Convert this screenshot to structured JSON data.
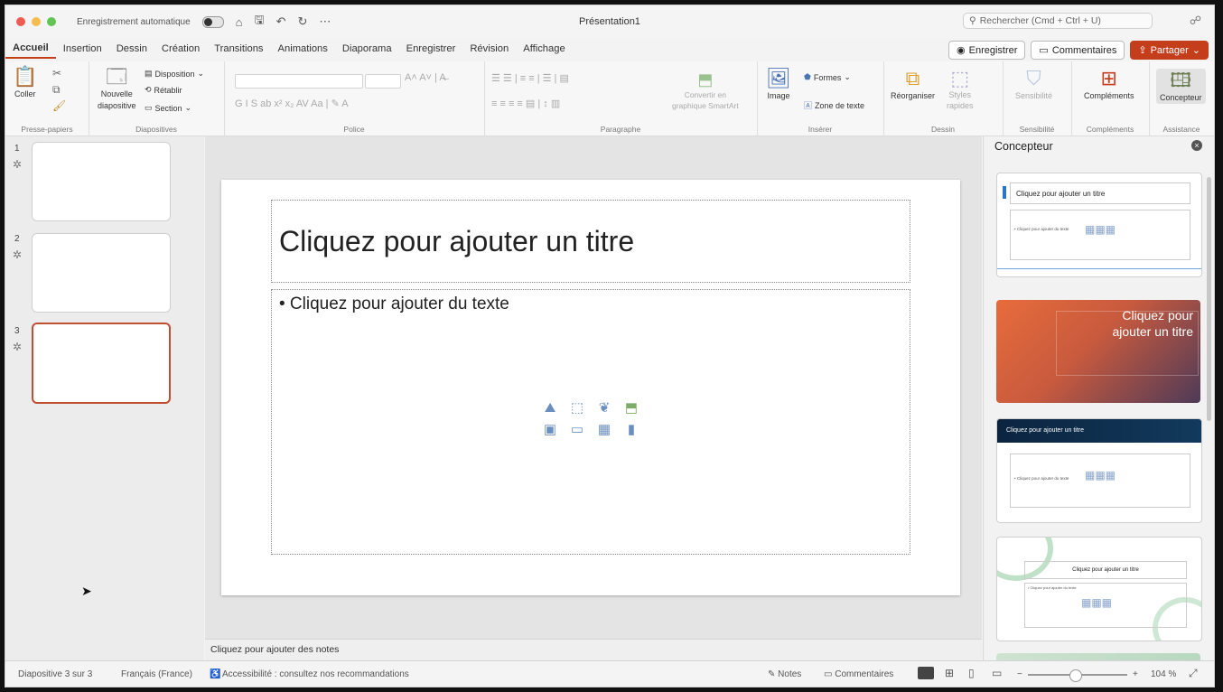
{
  "window": {
    "autosave_label": "Enregistrement automatique",
    "doc_title": "Présentation1"
  },
  "search": {
    "placeholder": "Rechercher (Cmd + Ctrl + U)"
  },
  "tabs": [
    "Accueil",
    "Insertion",
    "Dessin",
    "Création",
    "Transitions",
    "Animations",
    "Diaporama",
    "Enregistrer",
    "Révision",
    "Affichage"
  ],
  "tab_actions": {
    "record": "Enregistrer",
    "comments": "Commentaires",
    "share": "Partager"
  },
  "ribbon": {
    "clipboard": {
      "paste": "Coller",
      "group": "Presse-papiers"
    },
    "slides": {
      "new_slide_line1": "Nouvelle",
      "new_slide_line2": "diapositive",
      "layout": "Disposition",
      "reset": "Rétablir",
      "section": "Section",
      "group": "Diapositives"
    },
    "font": {
      "group": "Police"
    },
    "paragraph": {
      "smartart_line1": "Convertir en",
      "smartart_line2": "graphique SmartArt",
      "group": "Paragraphe"
    },
    "insert": {
      "image": "Image",
      "shapes": "Formes",
      "textbox": "Zone de texte",
      "group": "Insérer"
    },
    "drawing": {
      "arrange": "Réorganiser",
      "styles_line1": "Styles",
      "styles_line2": "rapides",
      "group": "Dessin"
    },
    "sensitivity": {
      "label": "Sensibilité",
      "group": "Sensibilité"
    },
    "addins": {
      "label": "Compléments",
      "group": "Compléments"
    },
    "designer": {
      "label": "Concepteur",
      "group": "Assistance"
    }
  },
  "thumbnails": [
    {
      "number": "1"
    },
    {
      "number": "2"
    },
    {
      "number": "3"
    }
  ],
  "slide": {
    "title_placeholder": "Cliquez pour ajouter un titre",
    "body_placeholder": "• Cliquez pour ajouter du texte"
  },
  "notes_placeholder": "Cliquez pour ajouter des notes",
  "designer": {
    "title": "Concepteur",
    "cards": [
      {
        "title": "Cliquez pour ajouter un titre",
        "body": "• Cliquez pour ajouter du texte"
      },
      {
        "title": "Cliquez pour ajouter un titre"
      },
      {
        "title": "Cliquez pour ajouter un titre",
        "body": "• Cliquez pour ajouter du texte"
      },
      {
        "title": "Cliquez pour ajouter un titre",
        "body": "• Cliquez pour ajouter du texte"
      }
    ]
  },
  "status": {
    "slide_count": "Diapositive 3 sur 3",
    "language": "Français (France)",
    "accessibility": "Accessibilité : consultez nos recommandations",
    "notes": "Notes",
    "comments": "Commentaires",
    "zoom": "104 %"
  },
  "colors": {
    "accent": "#c43e1c",
    "selected_border": "#c14f31"
  }
}
